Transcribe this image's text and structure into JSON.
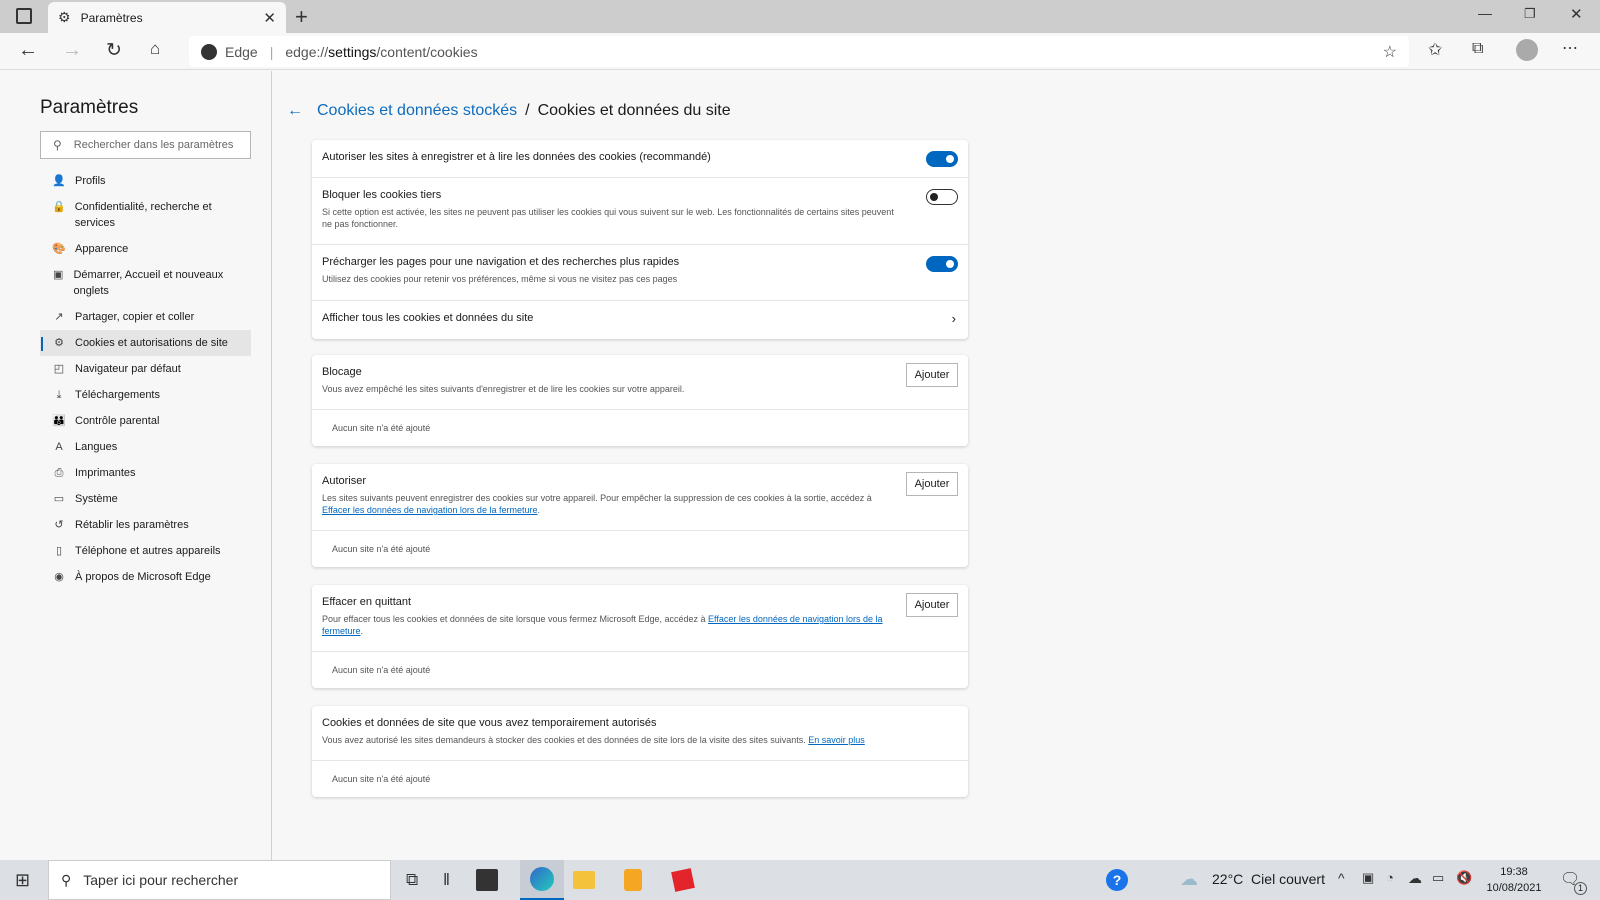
{
  "browser": {
    "tab_title": "Paramètres",
    "site_label": "Edge",
    "url_prefix": "edge://",
    "url_bold": "settings",
    "url_rest": "/content/cookies"
  },
  "sidebar": {
    "title": "Paramètres",
    "search_placeholder": "Rechercher dans les paramètres",
    "items": [
      {
        "label": "Profils",
        "icon": "👤"
      },
      {
        "label": "Confidentialité, recherche et services",
        "icon": "🔒"
      },
      {
        "label": "Apparence",
        "icon": "🎨"
      },
      {
        "label": "Démarrer, Accueil et nouveaux onglets",
        "icon": "▣"
      },
      {
        "label": "Partager, copier et coller",
        "icon": "↗"
      },
      {
        "label": "Cookies et autorisations de site",
        "icon": "⚙"
      },
      {
        "label": "Navigateur par défaut",
        "icon": "◰"
      },
      {
        "label": "Téléchargements",
        "icon": "⤓"
      },
      {
        "label": "Contrôle parental",
        "icon": "👪"
      },
      {
        "label": "Langues",
        "icon": "A"
      },
      {
        "label": "Imprimantes",
        "icon": "⎙"
      },
      {
        "label": "Système",
        "icon": "▭"
      },
      {
        "label": "Rétablir les paramètres",
        "icon": "↺"
      },
      {
        "label": "Téléphone et autres appareils",
        "icon": "▯"
      },
      {
        "label": "À propos de Microsoft Edge",
        "icon": "◉"
      }
    ]
  },
  "breadcrumb": {
    "parent": "Cookies et données stockés",
    "sep": "/",
    "current": "Cookies et données du site"
  },
  "settings": [
    {
      "title": "Autoriser les sites à enregistrer et à lire les données des cookies (recommandé)",
      "enabled": true
    },
    {
      "title": "Bloquer les cookies tiers",
      "desc": "Si cette option est activée, les sites ne peuvent pas utiliser les cookies qui vous suivent sur le web. Les fonctionnalités de certains sites peuvent ne pas fonctionner.",
      "enabled": false
    },
    {
      "title": "Précharger les pages pour une navigation et des recherches plus rapides",
      "desc": "Utilisez des cookies pour retenir vos préférences, même si vous ne visitez pas ces pages",
      "enabled": true
    },
    {
      "title": "Afficher tous les cookies et données du site"
    }
  ],
  "lists": {
    "add_label": "Ajouter",
    "empty": "Aucun site n'a été ajouté",
    "block": {
      "title": "Blocage",
      "desc": "Vous avez empêché les sites suivants d'enregistrer et de lire les cookies sur votre appareil."
    },
    "allow": {
      "title": "Autoriser",
      "desc": "Les sites suivants peuvent enregistrer des cookies sur votre appareil. Pour empêcher la suppression de ces cookies à la sortie, accédez à ",
      "link": "Effacer les données de navigation lors de la fermeture"
    },
    "clear": {
      "title": "Effacer en quittant",
      "desc": "Pour effacer tous les cookies et données de site lorsque vous fermez Microsoft Edge, accédez à ",
      "link": "Effacer les données de navigation lors de la fermeture"
    },
    "temp": {
      "title": "Cookies et données de site que vous avez temporairement autorisés",
      "desc": "Vous avez autorisé les sites demandeurs à stocker des cookies et des données de site lors de la visite des sites suivants. ",
      "link": "En savoir plus"
    }
  },
  "taskbar": {
    "search_placeholder": "Taper ici pour rechercher",
    "weather": "22°C  Ciel couvert",
    "time": "19:38",
    "date": "10/08/2021",
    "notif_count": "1"
  }
}
